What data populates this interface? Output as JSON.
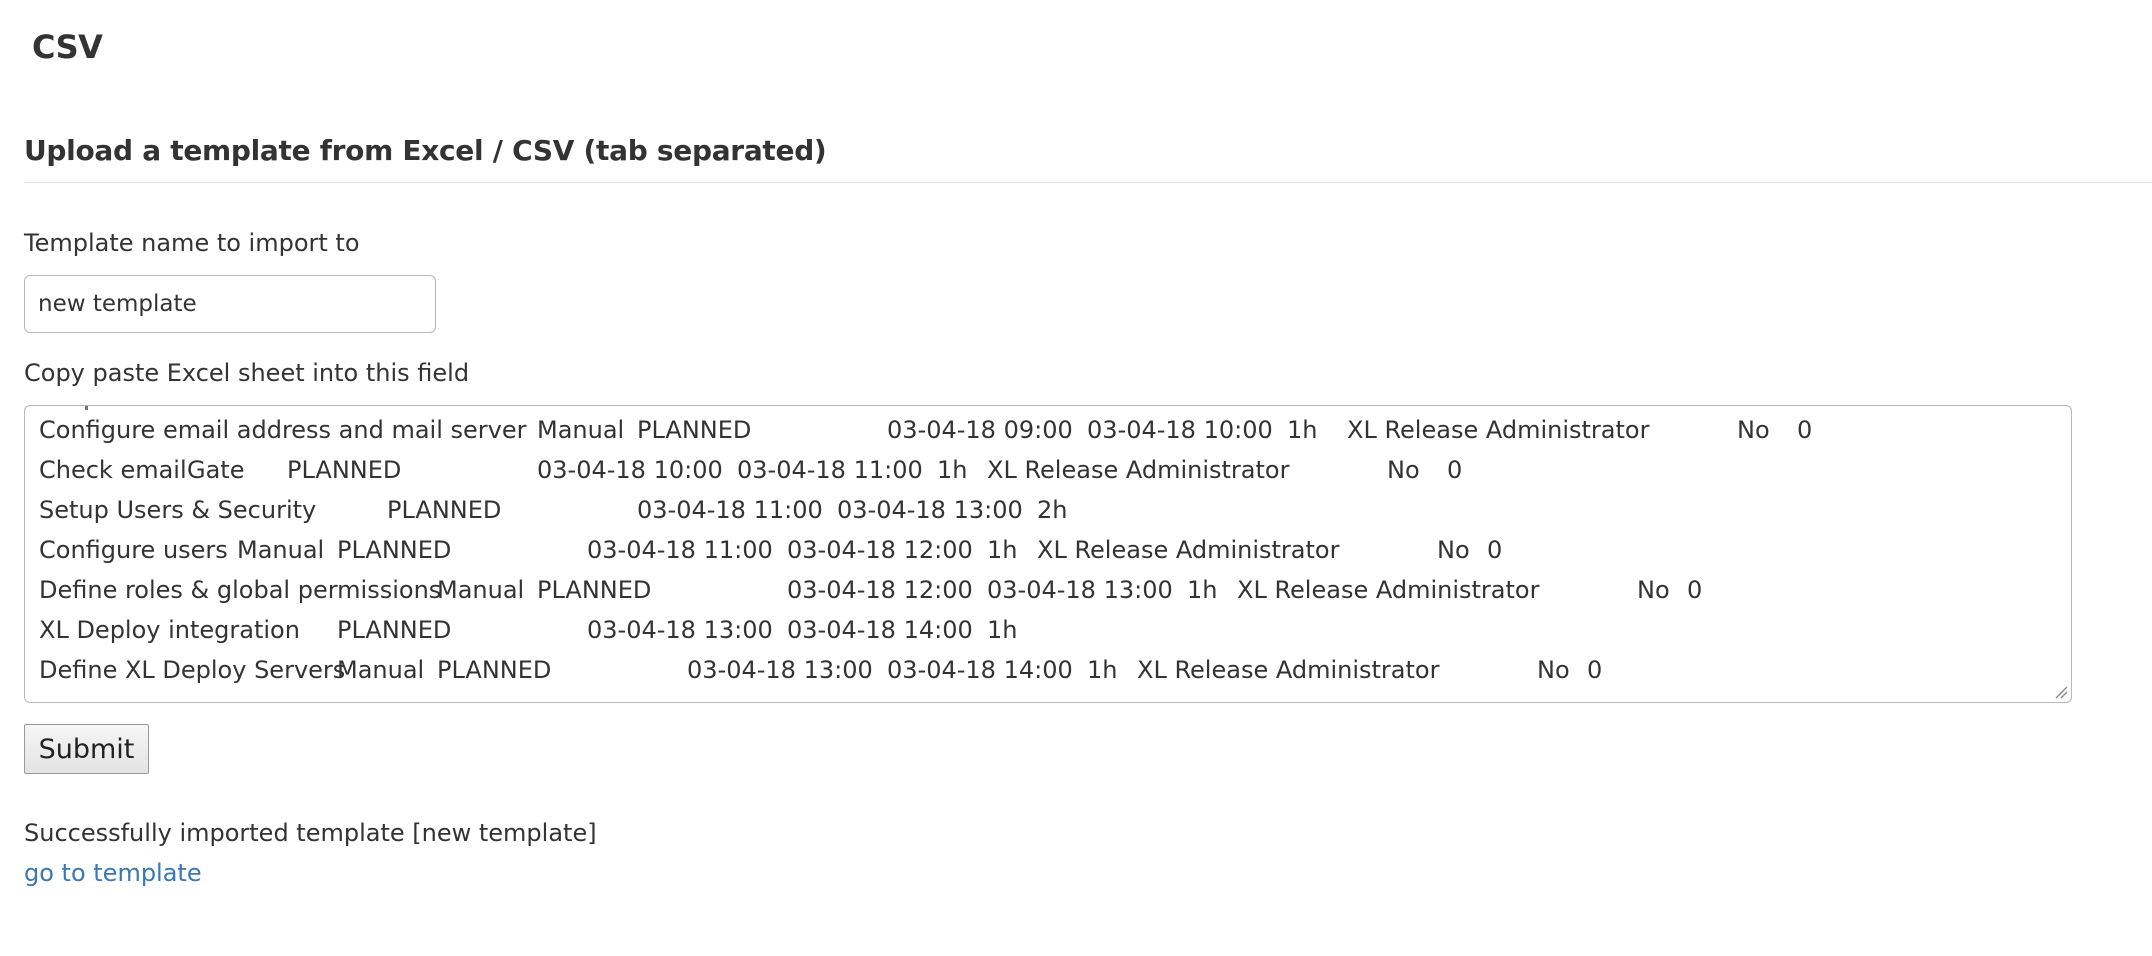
{
  "page": {
    "title": "CSV"
  },
  "upload": {
    "heading": "Upload a template from Excel / CSV (tab separated)",
    "template_name_label": "Template name to import to",
    "template_name_value": "new template",
    "paste_label": "Copy paste Excel sheet into this field",
    "paste_lines": [
      [
        {
          "text": "Configure email address and mail server",
          "col": 0
        },
        {
          "text": "Manual",
          "col": 1
        },
        {
          "text": "PLANNED",
          "col": 2
        },
        {
          "text": "03-04-18 09:00",
          "col": 3
        },
        {
          "text": "03-04-18 10:00",
          "col": 4
        },
        {
          "text": "1h",
          "col": 5
        },
        {
          "text": "XL Release Administrator",
          "col": 6
        },
        {
          "text": "No",
          "col": 7
        },
        {
          "text": "0",
          "col": 8
        }
      ],
      [
        {
          "text": "Check email",
          "col": 0
        },
        {
          "text": "Gate",
          "col": 1
        },
        {
          "text": "PLANNED",
          "col": 2
        },
        {
          "text": "03-04-18 10:00",
          "col": 3
        },
        {
          "text": "03-04-18 11:00",
          "col": 4
        },
        {
          "text": "1h",
          "col": 5
        },
        {
          "text": "XL Release Administrator",
          "col": 6
        },
        {
          "text": "No",
          "col": 7
        },
        {
          "text": "0",
          "col": 8
        }
      ],
      [
        {
          "text": "Setup Users & Security",
          "col": 0
        },
        {
          "text": "PLANNED",
          "col": 2
        },
        {
          "text": "03-04-18 11:00",
          "col": 3
        },
        {
          "text": "03-04-18 13:00",
          "col": 4
        },
        {
          "text": "2h",
          "col": 5
        }
      ],
      [
        {
          "text": "Configure users",
          "col": 0
        },
        {
          "text": "Manual",
          "col": 1
        },
        {
          "text": "PLANNED",
          "col": 2
        },
        {
          "text": "03-04-18 11:00",
          "col": 3
        },
        {
          "text": "03-04-18 12:00",
          "col": 4
        },
        {
          "text": "1h",
          "col": 5
        },
        {
          "text": "XL Release Administrator",
          "col": 6
        },
        {
          "text": "No",
          "col": 7
        },
        {
          "text": "0",
          "col": 8
        }
      ],
      [
        {
          "text": "Define roles & global permissions",
          "col": 0
        },
        {
          "text": "Manual",
          "col": 1
        },
        {
          "text": "PLANNED",
          "col": 2
        },
        {
          "text": "03-04-18 12:00",
          "col": 3
        },
        {
          "text": "03-04-18 13:00",
          "col": 4
        },
        {
          "text": "1h",
          "col": 5
        },
        {
          "text": "XL Release Administrator",
          "col": 6
        },
        {
          "text": "No",
          "col": 7
        },
        {
          "text": "0",
          "col": 8
        }
      ],
      [
        {
          "text": "XL Deploy integration",
          "col": 0
        },
        {
          "text": "PLANNED",
          "col": 2
        },
        {
          "text": "03-04-18 13:00",
          "col": 3
        },
        {
          "text": "03-04-18 14:00",
          "col": 4
        },
        {
          "text": "1h",
          "col": 5
        }
      ],
      [
        {
          "text": "Define XL Deploy Servers",
          "col": 0
        },
        {
          "text": "Manual",
          "col": 1
        },
        {
          "text": "PLANNED",
          "col": 2
        },
        {
          "text": "03-04-18 13:00",
          "col": 3
        },
        {
          "text": "03-04-18 14:00",
          "col": 4
        },
        {
          "text": "1h",
          "col": 5
        },
        {
          "text": "XL Release Administrator",
          "col": 6
        },
        {
          "text": "No",
          "col": 7
        },
        {
          "text": "0",
          "col": 8
        }
      ]
    ],
    "submit_label": "Submit"
  },
  "result": {
    "message": "Successfully imported template [new template]",
    "link_label": "go to template",
    "link_color": "#3a77b5"
  }
}
